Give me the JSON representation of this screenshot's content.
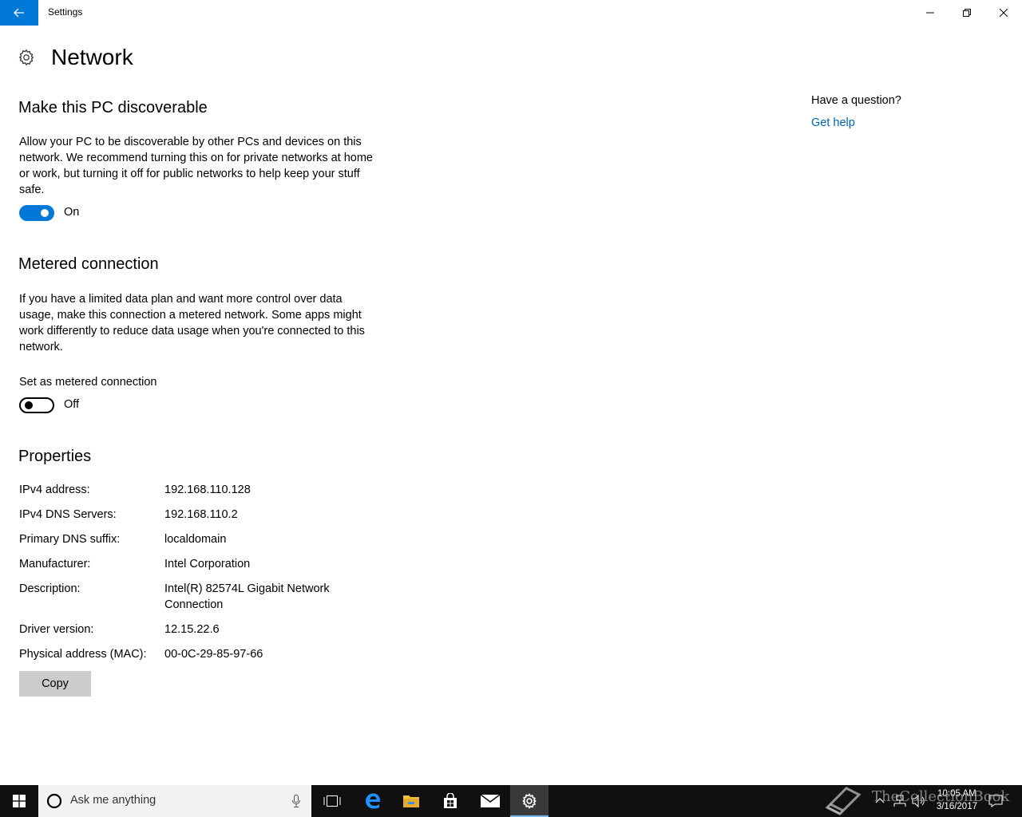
{
  "window": {
    "title": "Settings"
  },
  "page": {
    "title": "Network"
  },
  "discoverable": {
    "heading": "Make this PC discoverable",
    "description": "Allow your PC to be discoverable by other PCs and devices on this network. We recommend turning this on for private networks at home or work, but turning it off for public networks to help keep your stuff safe.",
    "toggle_state": "On"
  },
  "metered": {
    "heading": "Metered connection",
    "description": "If you have a limited data plan and want more control over data usage, make this connection a metered network. Some apps might work differently to reduce data usage when you're connected to this network.",
    "setting_label": "Set as metered connection",
    "toggle_state": "Off"
  },
  "properties": {
    "heading": "Properties",
    "rows": [
      {
        "label": "IPv4 address:",
        "value": "192.168.110.128"
      },
      {
        "label": "IPv4 DNS Servers:",
        "value": "192.168.110.2"
      },
      {
        "label": "Primary DNS suffix:",
        "value": "localdomain"
      },
      {
        "label": "Manufacturer:",
        "value": "Intel Corporation"
      },
      {
        "label": "Description:",
        "value": "Intel(R) 82574L Gigabit Network Connection"
      },
      {
        "label": "Driver version:",
        "value": "12.15.22.6"
      },
      {
        "label": "Physical address (MAC):",
        "value": "00-0C-29-85-97-66"
      }
    ],
    "copy_label": "Copy"
  },
  "help": {
    "question": "Have a question?",
    "link": "Get help"
  },
  "taskbar": {
    "search_placeholder": "Ask me anything",
    "time": "10:05 AM",
    "date": "3/16/2017",
    "watermark": "TheCollectionBook"
  },
  "colors": {
    "accent": "#0078d7",
    "link": "#0063b1",
    "taskbar": "#101010"
  }
}
